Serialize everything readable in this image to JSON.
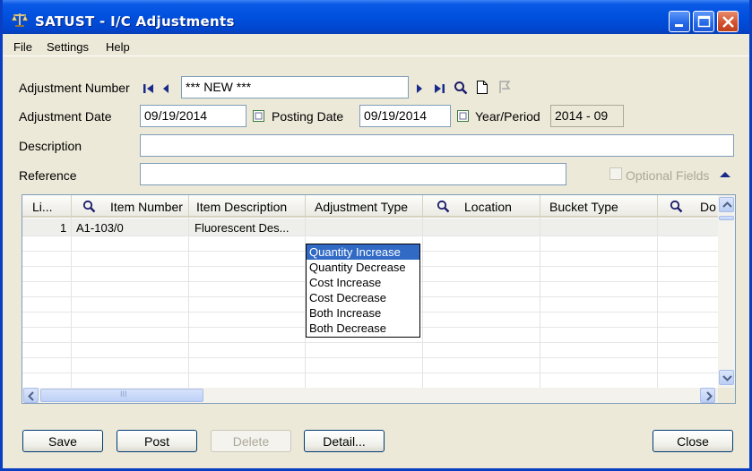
{
  "window": {
    "title": "SATUST - I/C Adjustments"
  },
  "menu": [
    "File",
    "Settings",
    "Help"
  ],
  "form": {
    "adjustment_number_label": "Adjustment Number",
    "adjustment_number_value": "*** NEW ***",
    "adjustment_date_label": "Adjustment Date",
    "adjustment_date_value": "09/19/2014",
    "posting_date_label": "Posting Date",
    "posting_date_value": "09/19/2014",
    "year_period_label": "Year/Period",
    "year_period_value": "2014 - 09",
    "description_label": "Description",
    "description_value": "",
    "reference_label": "Reference",
    "reference_value": "",
    "optional_fields_label": "Optional Fields"
  },
  "grid": {
    "columns": [
      "Li...",
      "Item Number",
      "Item Description",
      "Adjustment Type",
      "Location",
      "Bucket Type",
      "Do"
    ],
    "rows": [
      {
        "line": "1",
        "item_number": "A1-103/0",
        "item_description": "Fluorescent Des...",
        "adjustment_type": "Quantity Increa:"
      }
    ],
    "scroll_marker": "III"
  },
  "dropdown": {
    "options": [
      "Quantity Increase",
      "Quantity Decrease",
      "Cost Increase",
      "Cost Decrease",
      "Both Increase",
      "Both Decrease"
    ],
    "selected_index": 0
  },
  "buttons": {
    "save": "Save",
    "post": "Post",
    "delete": "Delete",
    "detail": "Detail...",
    "close": "Close"
  },
  "colors": {
    "titlebar": "#0050de",
    "selection": "#316ac5",
    "face": "#ece9d8"
  }
}
